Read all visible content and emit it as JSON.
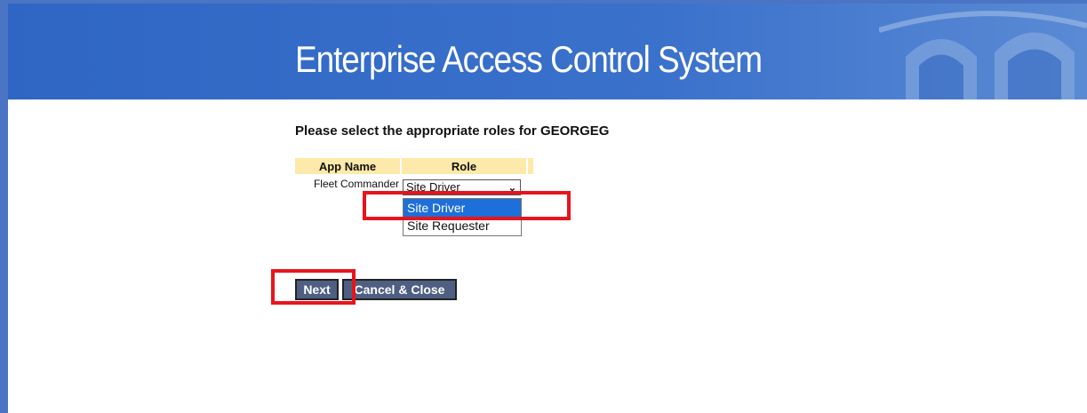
{
  "app": {
    "title": "Enterprise Access Control System"
  },
  "form": {
    "prompt": "Please select the appropriate roles for GEORGEG",
    "table": {
      "headers": [
        "App Name",
        "Role"
      ],
      "rows": [
        {
          "app_name": "Fleet Commander",
          "role_value": "Site Driver"
        }
      ]
    },
    "role_options": [
      "Site Driver",
      "Site Requester"
    ],
    "selected_option": "Site Driver"
  },
  "buttons": {
    "next": "Next",
    "cancel": "Cancel & Close"
  },
  "colors": {
    "banner": "#2f66c4",
    "header_cell": "#fde9a9",
    "button": "#4e5f82",
    "highlight": "#e8141c",
    "selection": "#1e6fd9"
  }
}
